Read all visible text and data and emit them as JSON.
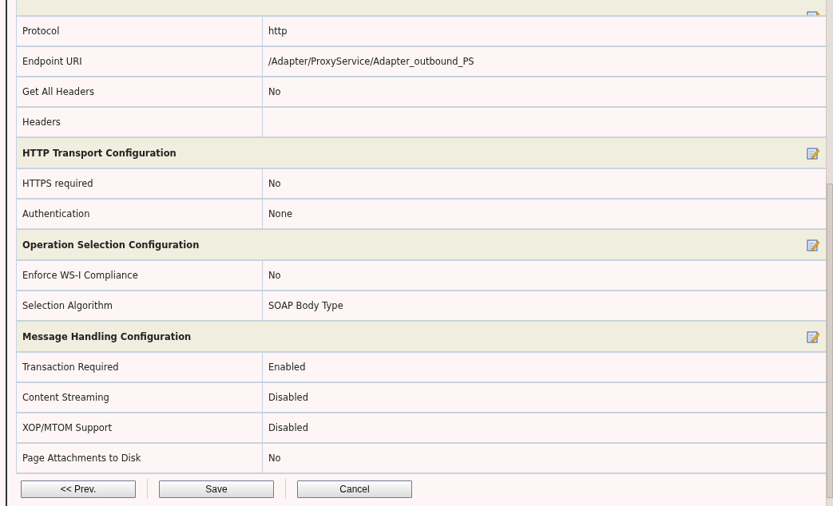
{
  "sections": [
    {
      "rows": [
        {
          "label": "Protocol",
          "value": "http"
        },
        {
          "label": "Endpoint URI",
          "value": "/Adapter/ProxyService/Adapter_outbound_PS"
        },
        {
          "label": "Get All Headers",
          "value": "No"
        },
        {
          "label": "Headers"
        }
      ]
    },
    {
      "title": "HTTP Transport Configuration",
      "rows": [
        {
          "label": "HTTPS required",
          "value": "No"
        },
        {
          "label": "Authentication",
          "value": "None"
        }
      ]
    },
    {
      "title": "Operation Selection Configuration",
      "rows": [
        {
          "label": "Enforce WS-I Compliance",
          "value": "No"
        },
        {
          "label": "Selection Algorithm",
          "value": "SOAP Body Type"
        }
      ]
    },
    {
      "title": "Message Handling Configuration",
      "rows": [
        {
          "label": "Transaction Required",
          "value": "Enabled"
        },
        {
          "label": "Content Streaming",
          "value": "Disabled"
        },
        {
          "label": "XOP/MTOM Support",
          "value": "Disabled"
        },
        {
          "label": "Page Attachments to Disk",
          "value": "No"
        }
      ]
    }
  ],
  "buttons": [
    "<< Prev.",
    "Save",
    "Cancel"
  ]
}
